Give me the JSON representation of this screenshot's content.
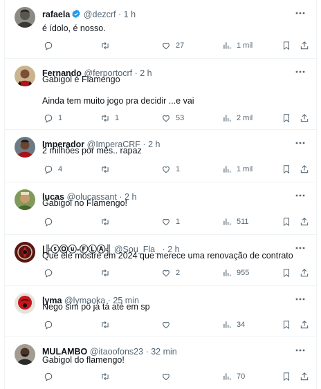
{
  "colors": {
    "text": "#0f1419",
    "muted": "#536471",
    "border": "#eff3f4",
    "verified": "#1d9bf0"
  },
  "icons": {
    "reply": "reply-icon",
    "retweet": "retweet-icon",
    "like": "heart-icon",
    "views": "views-icon",
    "bookmark": "bookmark-icon",
    "share": "share-icon",
    "more": "more-icon"
  },
  "tweets": [
    {
      "name": "rafaela",
      "verified": true,
      "handle": "@dezcrf",
      "dot": "·",
      "time": "1 h",
      "lines": [
        "é ídolo, é nosso."
      ],
      "reply": "",
      "retweet": "",
      "like": "27",
      "views": "1 mil"
    },
    {
      "name": "Fernando",
      "verified": false,
      "handle": "@ferportocrf",
      "dot": "·",
      "time": "2 h",
      "lines": [
        "Gabigol é Flamengo",
        "",
        "Ainda tem muito jogo pra decidir ...e vai"
      ],
      "reply": "1",
      "retweet": "1",
      "like": "53",
      "views": "2 mil"
    },
    {
      "name": "Imperador",
      "verified": false,
      "handle": "@ImperaCRF",
      "dot": "·",
      "time": "2 h",
      "lines": [
        "2 milhões por mês.. rapaz"
      ],
      "reply": "4",
      "retweet": "",
      "like": "1",
      "views": "1 mil"
    },
    {
      "name": "lucas",
      "verified": false,
      "handle": "@olucassant",
      "dot": "·",
      "time": "2 h",
      "lines": [
        "Gabigol no Flamengo!"
      ],
      "reply": "",
      "retweet": "",
      "like": "1",
      "views": "511"
    },
    {
      "name": "|╠ⓢⓄⓤ-ⒻⓁⒶ╣",
      "verified": false,
      "handle": "@Sou_Fla_",
      "dot": "·",
      "time": "2 h",
      "lines": [
        "Que ele mostre em 2024 que merece uma renovação de contrato"
      ],
      "reply": "",
      "retweet": "",
      "like": "2",
      "views": "955"
    },
    {
      "name": "lyma",
      "verified": false,
      "handle": "@lymaoka",
      "dot": "·",
      "time": "25 min",
      "lines": [
        "Nego sim pô já tá até em sp"
      ],
      "reply": "",
      "retweet": "",
      "like": "",
      "views": "34"
    },
    {
      "name": "MULAMBO",
      "verified": false,
      "handle": "@itaoofons23",
      "dot": "·",
      "time": "32 min",
      "lines": [
        "Gabigol do flamengo!"
      ],
      "reply": "",
      "retweet": "",
      "like": "",
      "views": "70"
    }
  ]
}
